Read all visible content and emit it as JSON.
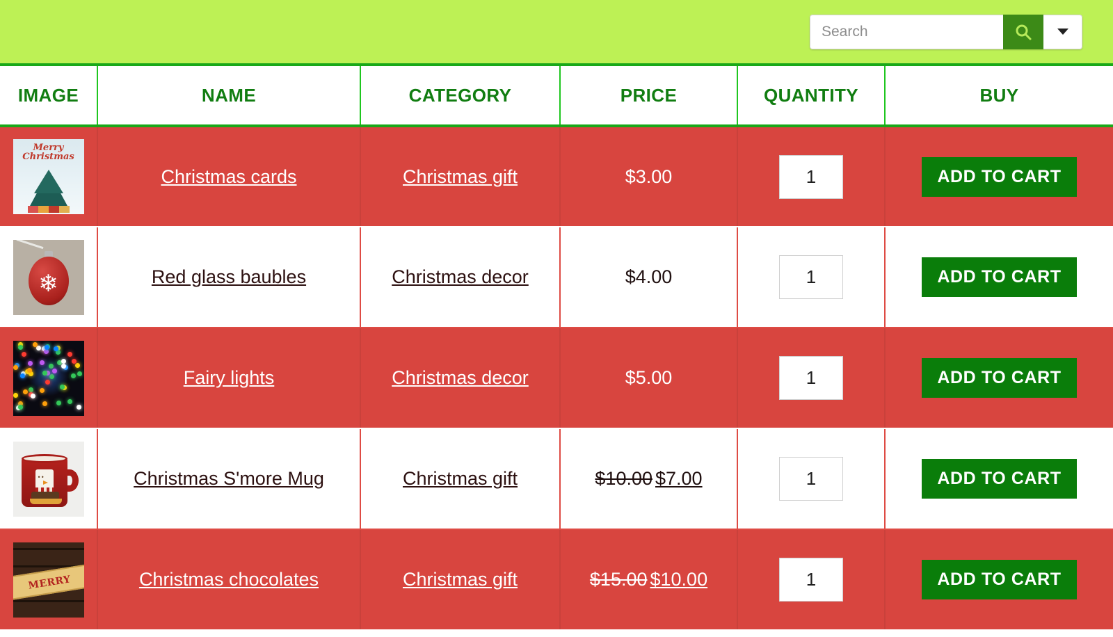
{
  "banner": {
    "background_color": "#bdf155",
    "search": {
      "placeholder": "Search",
      "value": "",
      "button_icon": "search-icon",
      "dropdown_icon": "chevron-down-icon"
    }
  },
  "table": {
    "columns": [
      "IMAGE",
      "NAME",
      "CATEGORY",
      "PRICE",
      "QUANTITY",
      "BUY"
    ],
    "header_color": "#117d11",
    "row_alt_color": "#d8453f",
    "button_color": "#0a7d0a",
    "rows": [
      {
        "image_alt": "christmas-card-thumbnail",
        "name": "Christmas cards",
        "category": "Christmas gift",
        "price": "$3.00",
        "old_price": "",
        "quantity": "1",
        "buy_label": "ADD TO CART"
      },
      {
        "image_alt": "red-glass-bauble-thumbnail",
        "name": "Red glass baubles",
        "category": "Christmas decor",
        "price": "$4.00",
        "old_price": "",
        "quantity": "1",
        "buy_label": "ADD TO CART"
      },
      {
        "image_alt": "fairy-lights-thumbnail",
        "name": "Fairy lights",
        "category": "Christmas decor",
        "price": "$5.00",
        "old_price": "",
        "quantity": "1",
        "buy_label": "ADD TO CART"
      },
      {
        "image_alt": "christmas-smore-mug-thumbnail",
        "name": "Christmas S'more Mug",
        "category": "Christmas gift",
        "price": "$7.00",
        "old_price": "$10.00",
        "quantity": "1",
        "buy_label": "ADD TO CART"
      },
      {
        "image_alt": "christmas-chocolates-thumbnail",
        "name": "Christmas chocolates",
        "category": "Christmas gift",
        "price": "$10.00",
        "old_price": "$15.00",
        "quantity": "1",
        "buy_label": "ADD TO CART"
      }
    ]
  },
  "thumb_text": {
    "card_line1": "Merry",
    "card_line2": "Christmas",
    "choc_banner": "MERRY CHRISTMAS",
    "mug_face": "••"
  }
}
